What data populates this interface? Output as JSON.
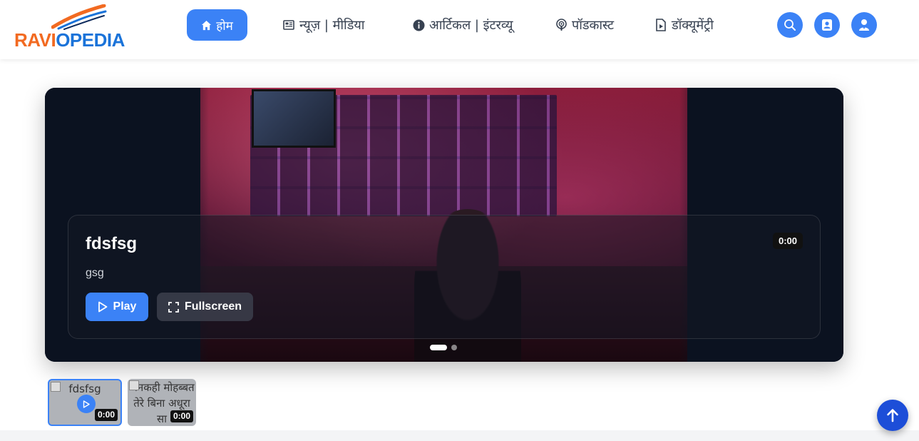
{
  "logo": {
    "part1": "RAVI",
    "part2": "OPEDIA"
  },
  "nav": {
    "home": "होम",
    "news": "न्यूज़ | मीडिया",
    "article": "आर्टिकल | इंटरव्यू",
    "podcast": "पॉडकास्ट",
    "documentary": "डॉक्यूमेंट्री"
  },
  "header_buttons": [
    "search-icon",
    "contact-card-icon",
    "user-icon"
  ],
  "hero": {
    "title": "fdsfsg",
    "subtitle": "gsg",
    "duration": "0:00",
    "play_label": "Play",
    "fullscreen_label": "Fullscreen",
    "slides": 2,
    "active_slide": 1
  },
  "thumbnails": [
    {
      "caption": "fdsfsg",
      "duration": "0:00",
      "active": true
    },
    {
      "caption": "अनकही मोहब्बत तेरे बिना अधूरा सा",
      "duration": "0:00",
      "active": false
    }
  ],
  "colors": {
    "accent": "#3b82f6",
    "logo_orange": "#f26a21",
    "logo_blue": "#1a73d9",
    "scroll_top": "#1d4ed8"
  }
}
